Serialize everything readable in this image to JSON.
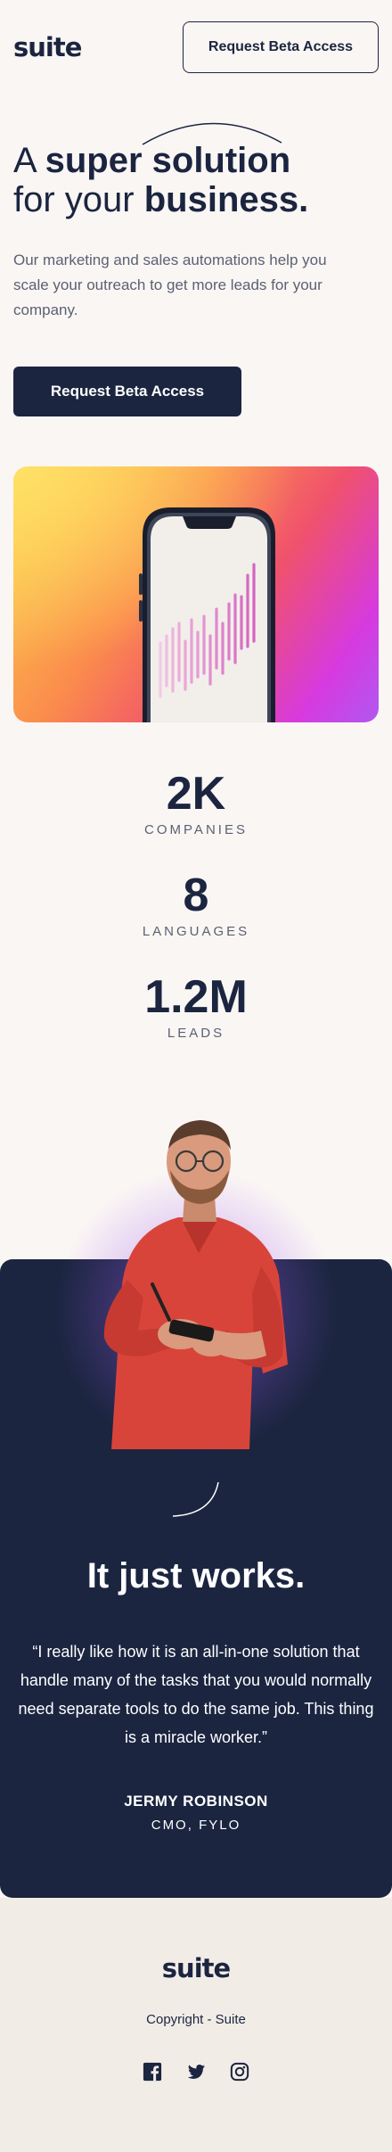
{
  "header": {
    "logo": "suite",
    "cta_label": "Request Beta Access"
  },
  "hero": {
    "title_prefix": "A ",
    "title_bold_1": "super solution",
    "title_middle": "for your ",
    "title_bold_2": "business.",
    "description": "Our marketing and sales automations help you scale your outreach to get more leads for your company.",
    "cta_label": "Request Beta Access"
  },
  "stats": [
    {
      "value": "2K",
      "label": "COMPANIES"
    },
    {
      "value": "8",
      "label": "LANGUAGES"
    },
    {
      "value": "1.2M",
      "label": "LEADS"
    }
  ],
  "testimonial": {
    "title_prefix": "It just ",
    "title_bold": "works.",
    "quote": "“I really like how it is an all-in-one solution that handle many of the tasks that you would normally need separate tools to do the same job. This thing is a miracle worker.”",
    "name": "JERMY ROBINSON",
    "role": "CMO, FYLO"
  },
  "footer": {
    "logo": "suite",
    "copyright": "Copyright - Suite",
    "socials": [
      "facebook-icon",
      "twitter-icon",
      "instagram-icon"
    ]
  },
  "colors": {
    "navy": "#1b2540",
    "background": "#faf6f4",
    "footer_bg": "#f2ece7",
    "muted_text": "#5b6173"
  }
}
